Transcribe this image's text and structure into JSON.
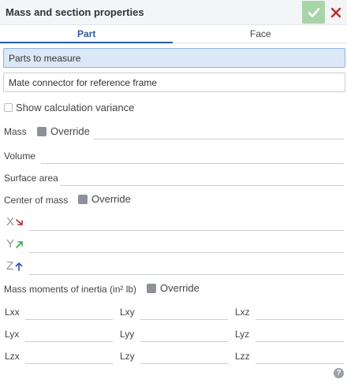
{
  "dialog": {
    "title": "Mass and section properties"
  },
  "header": {
    "ok_icon": "checkmark-icon",
    "cancel_icon": "close-icon",
    "accent": "#a7d5a9",
    "close_color": "#c0282d"
  },
  "tabs": [
    {
      "label": "Part"
    },
    {
      "label": "Face"
    }
  ],
  "selections": {
    "parts": {
      "placeholder": "Parts to measure"
    },
    "mate": {
      "placeholder": "Mate connector for reference frame"
    }
  },
  "variance": {
    "label": "Show calculation variance"
  },
  "mass": {
    "label": "Mass",
    "override_label": "Override"
  },
  "volume": {
    "label": "Volume"
  },
  "surface": {
    "label": "Surface area"
  },
  "center": {
    "label": "Center of mass",
    "override_label": "Override",
    "axes": [
      {
        "label": "X"
      },
      {
        "label": "Y"
      },
      {
        "label": "Z"
      }
    ]
  },
  "inertia": {
    "label": "Mass moments of inertia (in² lb)",
    "override_label": "Override",
    "cells": [
      {
        "label": "Lxx"
      },
      {
        "label": "Lxy"
      },
      {
        "label": "Lxz"
      },
      {
        "label": "Lyx"
      },
      {
        "label": "Lyy"
      },
      {
        "label": "Lyz"
      },
      {
        "label": "Lzx"
      },
      {
        "label": "Lzy"
      },
      {
        "label": "Lzz"
      }
    ]
  },
  "help": {
    "glyph": "?",
    "icon": "help-icon"
  }
}
